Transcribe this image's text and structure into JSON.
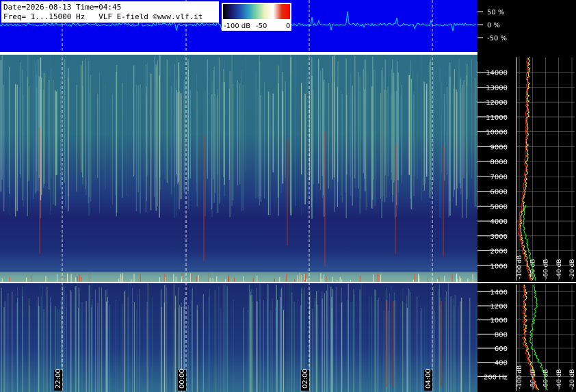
{
  "header": {
    "line1": "Date=2026-08-13 Time=04:45",
    "line2": "Freq= 1...15000 Hz   VLF E-field ©www.vlf.it"
  },
  "colorbar": {
    "labels": [
      "-100 dB",
      "-50",
      "0"
    ],
    "colors": [
      "#000000",
      "#1a1a6e",
      "#1f4fb0",
      "#2b9cc4",
      "#7fd6a0",
      "#f2f2c0",
      "#ffffff",
      "#e03010",
      "#ff0000"
    ]
  },
  "waveform": {
    "y_labels": [
      "50 %",
      "0 %",
      "-50 %"
    ],
    "background": "#0000ee",
    "trace_color": "#00d8ff"
  },
  "time_labels": [
    "22:00",
    "00:00",
    "02:00",
    "04:00"
  ],
  "chart_data": [
    {
      "type": "heatmap",
      "name_hint": "upper",
      "ylim": [
        0,
        15000
      ],
      "y_ticks": [
        1000,
        2000,
        3000,
        4000,
        5000,
        6000,
        7000,
        8000,
        9000,
        10000,
        11000,
        12000,
        13000,
        14000
      ],
      "y_tick_labels": [
        "1000",
        "2000",
        "3000",
        "4000",
        "5000",
        "6000",
        "7000",
        "8000",
        "9000",
        "10000",
        "11000",
        "12000",
        "13000",
        "14000"
      ],
      "x_ticks": [
        "22:00",
        "00:00",
        "02:00",
        "04:00"
      ],
      "spectrum_x_labels": [
        "-100 dB",
        "-80 dB",
        "-60 dB",
        "-40 dB",
        "-20 dB"
      ]
    },
    {
      "type": "heatmap",
      "name_hint": "lower",
      "ylim": [
        0,
        1500
      ],
      "y_ticks": [
        200,
        400,
        600,
        800,
        1000,
        1200,
        1400
      ],
      "y_tick_labels": [
        "200 Hz",
        "400",
        "600",
        "800",
        "1000",
        "1200",
        "1400"
      ],
      "x_ticks": [
        "22:00",
        "00:00",
        "02:00",
        "04:00"
      ],
      "spectrum_x_labels": [
        "-100 dB",
        "-80 dB",
        "-60 dB",
        "-40 dB",
        "-20 dB"
      ]
    }
  ]
}
